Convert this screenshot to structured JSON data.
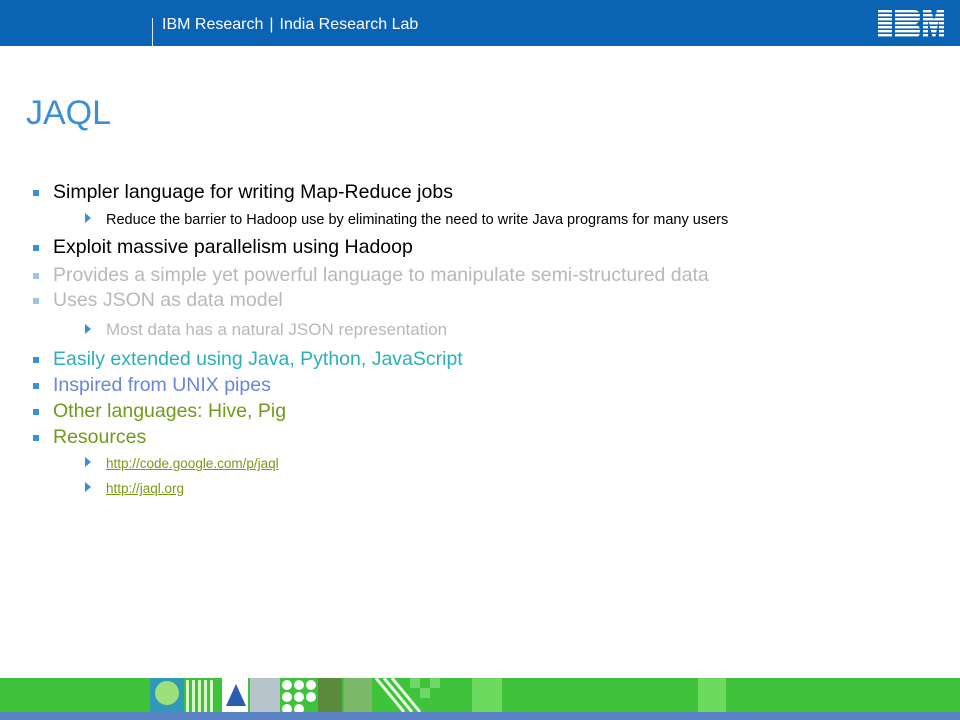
{
  "header": {
    "org": "IBM Research",
    "separator": "|",
    "lab": "India Research Lab",
    "logo_text": "IBM",
    "color": "#0b63b3"
  },
  "slide": {
    "title": "JAQL",
    "bullets": [
      {
        "text": "Simpler language for writing Map-Reduce jobs",
        "color": "#000000"
      },
      {
        "text": "Reduce the barrier to Hadoop use by eliminating the need to write Java programs for many users",
        "color": "#000000"
      },
      {
        "text": "Exploit massive parallelism using Hadoop",
        "color": "#000000"
      },
      {
        "text": "Provides a simple yet powerful language to manipulate semi-structured data",
        "color": "#b8b8b8"
      },
      {
        "text": "Uses JSON as data model",
        "color": "#b8b8b8"
      },
      {
        "text": "Most data has a natural JSON representation",
        "color": "#b8b8b8"
      },
      {
        "text": "Easily extended using Java, Python, JavaScript",
        "color": "#2ab0b8"
      },
      {
        "text": "Inspired from UNIX pipes",
        "color": "#6a86d8"
      },
      {
        "text": "Other languages: Hive, Pig",
        "color": "#6f9a1a"
      },
      {
        "text": "Resources",
        "color": "#6f9a1a"
      }
    ],
    "links": [
      "http://code.google.com/p/jaql",
      "http://jaql.org"
    ]
  },
  "footer": {
    "color": "#3ec33a"
  }
}
